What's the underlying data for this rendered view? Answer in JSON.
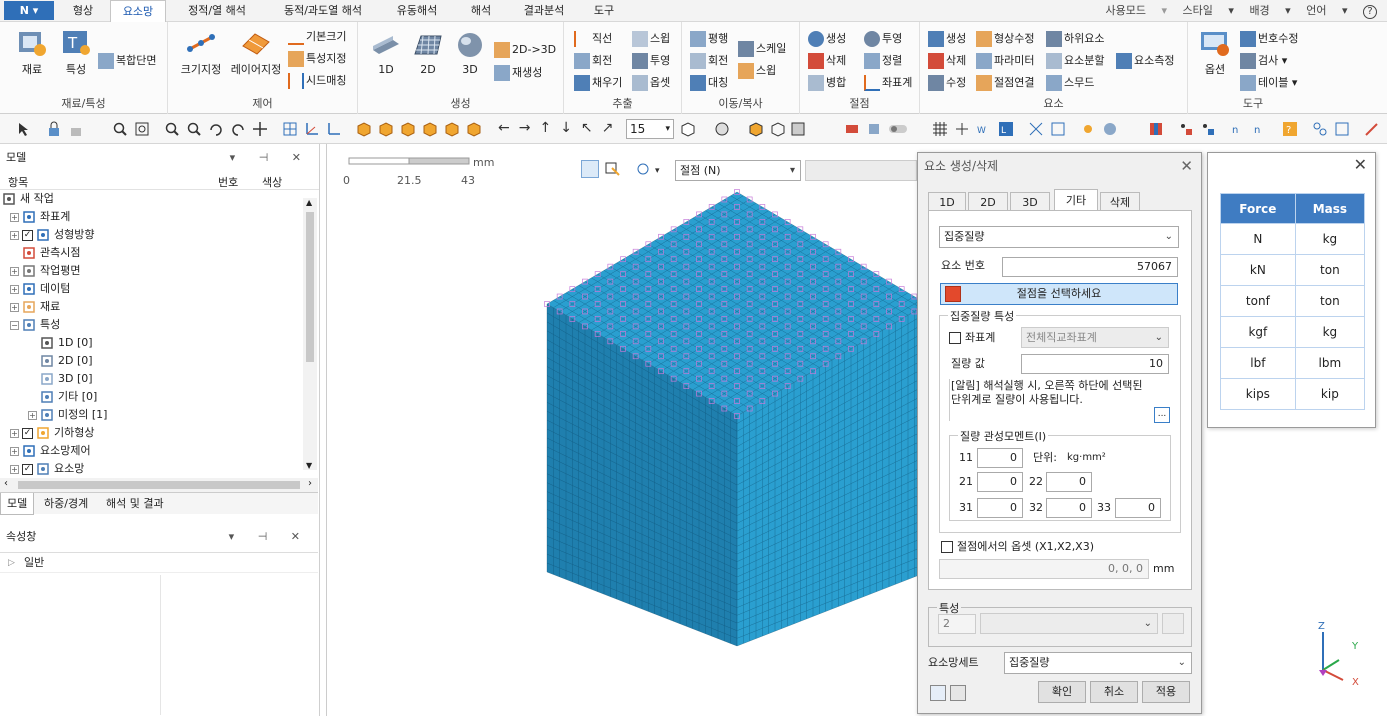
{
  "menubar": {
    "app": "N",
    "tabs": [
      "형상",
      "요소망",
      "정적/열 해석",
      "동적/과도열 해석",
      "유동해석",
      "해석",
      "결과분석",
      "도구"
    ],
    "active": 1,
    "right": [
      "사용모드",
      "스타일",
      "배경",
      "언어",
      "?"
    ]
  },
  "ribbon": {
    "groups": [
      {
        "title": "재료/특성",
        "items": [
          "재료",
          "특성",
          "복합단면"
        ]
      },
      {
        "title": "제어",
        "items": [
          "크기지정",
          "레이어지정",
          "기본크기",
          "특성지정",
          "시드매칭"
        ]
      },
      {
        "title": "생성",
        "items": [
          "1D",
          "2D",
          "3D",
          "2D->3D",
          "재생성"
        ]
      },
      {
        "title": "추출",
        "items": [
          "직선",
          "스윕",
          "회전",
          "투영",
          "채우기",
          "옵셋"
        ]
      },
      {
        "title": "이동/복사",
        "items": [
          "평행",
          "스케일",
          "회전",
          "스윕",
          "대칭"
        ]
      },
      {
        "title": "절점",
        "items": [
          "생성",
          "투영",
          "삭제",
          "정렬",
          "병합",
          "좌표계"
        ]
      },
      {
        "title": "요소",
        "items": [
          "생성",
          "형상수정",
          "하위요소",
          "삭제",
          "파라미터",
          "요소분할",
          "요소측정",
          "수정",
          "절점연결",
          "스무드"
        ]
      },
      {
        "title": "도구",
        "items": [
          "옵션",
          "번호수정",
          "검사",
          "테이블"
        ]
      }
    ]
  },
  "toolbar": {
    "zoom_value": "15"
  },
  "model_panel": {
    "title": "모델",
    "col_item": "항목",
    "col_num": "번호",
    "col_color": "색상",
    "tree": [
      {
        "label": "새 작업",
        "level": 0,
        "expander": "",
        "checkbox": "",
        "icon": "work-icon"
      },
      {
        "label": "좌표계",
        "level": 1,
        "expander": "+",
        "checkbox": "",
        "icon": "coord-icon"
      },
      {
        "label": "성형방향",
        "level": 1,
        "expander": "+",
        "checkbox": "✓",
        "icon": "direction-icon"
      },
      {
        "label": "관측시점",
        "level": 1,
        "expander": "",
        "checkbox": "",
        "icon": "view-icon"
      },
      {
        "label": "작업평면",
        "level": 1,
        "expander": "+",
        "checkbox": "",
        "icon": "grid-icon"
      },
      {
        "label": "데이텀",
        "level": 1,
        "expander": "+",
        "checkbox": "",
        "icon": "datum-icon"
      },
      {
        "label": "재료",
        "level": 1,
        "expander": "+",
        "checkbox": "",
        "icon": "material-icon"
      },
      {
        "label": "특성",
        "level": 1,
        "expander": "-",
        "checkbox": "",
        "icon": "property-icon"
      },
      {
        "label": "1D [0]",
        "level": 2,
        "expander": "",
        "checkbox": "",
        "icon": "line-icon"
      },
      {
        "label": "2D [0]",
        "level": 2,
        "expander": "",
        "checkbox": "",
        "icon": "plate-icon"
      },
      {
        "label": "3D [0]",
        "level": 2,
        "expander": "",
        "checkbox": "",
        "icon": "solid-icon"
      },
      {
        "label": "기타 [0]",
        "level": 2,
        "expander": "",
        "checkbox": "",
        "icon": "property-icon"
      },
      {
        "label": "미정의 [1]",
        "level": 2,
        "expander": "+",
        "checkbox": "",
        "icon": "property-icon"
      },
      {
        "label": "기하형상",
        "level": 1,
        "expander": "+",
        "checkbox": "✓",
        "icon": "geometry-icon"
      },
      {
        "label": "요소망제어",
        "level": 1,
        "expander": "+",
        "checkbox": "",
        "icon": "mesh-control-icon"
      },
      {
        "label": "요소망",
        "level": 1,
        "expander": "+",
        "checkbox": "✓",
        "icon": "mesh-icon"
      }
    ],
    "tabs": [
      "모델",
      "하중/경계",
      "해석 및 결과"
    ]
  },
  "property_panel": {
    "title": "속성창",
    "group": "일반"
  },
  "viewport": {
    "scale_labels": [
      "0",
      "21.5",
      "43"
    ],
    "scale_unit": "mm",
    "snap_select": "절점 (N)",
    "triad": {
      "z": "Z",
      "y": "Y",
      "x": "X"
    },
    "mesh_color": "#2a9fd0"
  },
  "dialog": {
    "title": "요소 생성/삭제",
    "tabs": [
      "1D",
      "2D",
      "3D",
      "기타",
      "삭제"
    ],
    "active_tab": 3,
    "type_select": "집중질량",
    "elem_no_label": "요소 번호",
    "elem_no": "57067",
    "pick_label": "절점을 선택하세요",
    "mass_group": "집중질량 특성",
    "coord_label": "좌표계",
    "coord_select": "전체직교좌표계",
    "mass_label": "질량 값",
    "mass_value": "10",
    "note": "[알림] 해석실행 시, 오른쪽 하단에 선택된 단위계로 질량이 사용됩니다.",
    "inertia_group": "질량 관성모멘트(I)",
    "i11_label": "11",
    "i11": "0",
    "unit_label": "단위:",
    "unit_value": "kg·mm²",
    "i21_label": "21",
    "i21": "0",
    "i22_label": "22",
    "i22": "0",
    "i31_label": "31",
    "i31": "0",
    "i32_label": "32",
    "i32": "0",
    "i33_label": "33",
    "i33": "0",
    "offset_label": "절점에서의 옵셋 (X1,X2,X3)",
    "offset_value": "0, 0, 0",
    "offset_unit": "mm",
    "prop_group": "특성",
    "prop_no": "2",
    "meshset_label": "요소망세트",
    "meshset_value": "집중질량",
    "ok": "확인",
    "cancel": "취소",
    "apply": "적용"
  },
  "unit_table": {
    "headers": [
      "Force",
      "Mass"
    ],
    "rows": [
      [
        "N",
        "kg"
      ],
      [
        "kN",
        "ton"
      ],
      [
        "tonf",
        "ton"
      ],
      [
        "kgf",
        "kg"
      ],
      [
        "lbf",
        "lbm"
      ],
      [
        "kips",
        "kip"
      ]
    ]
  }
}
